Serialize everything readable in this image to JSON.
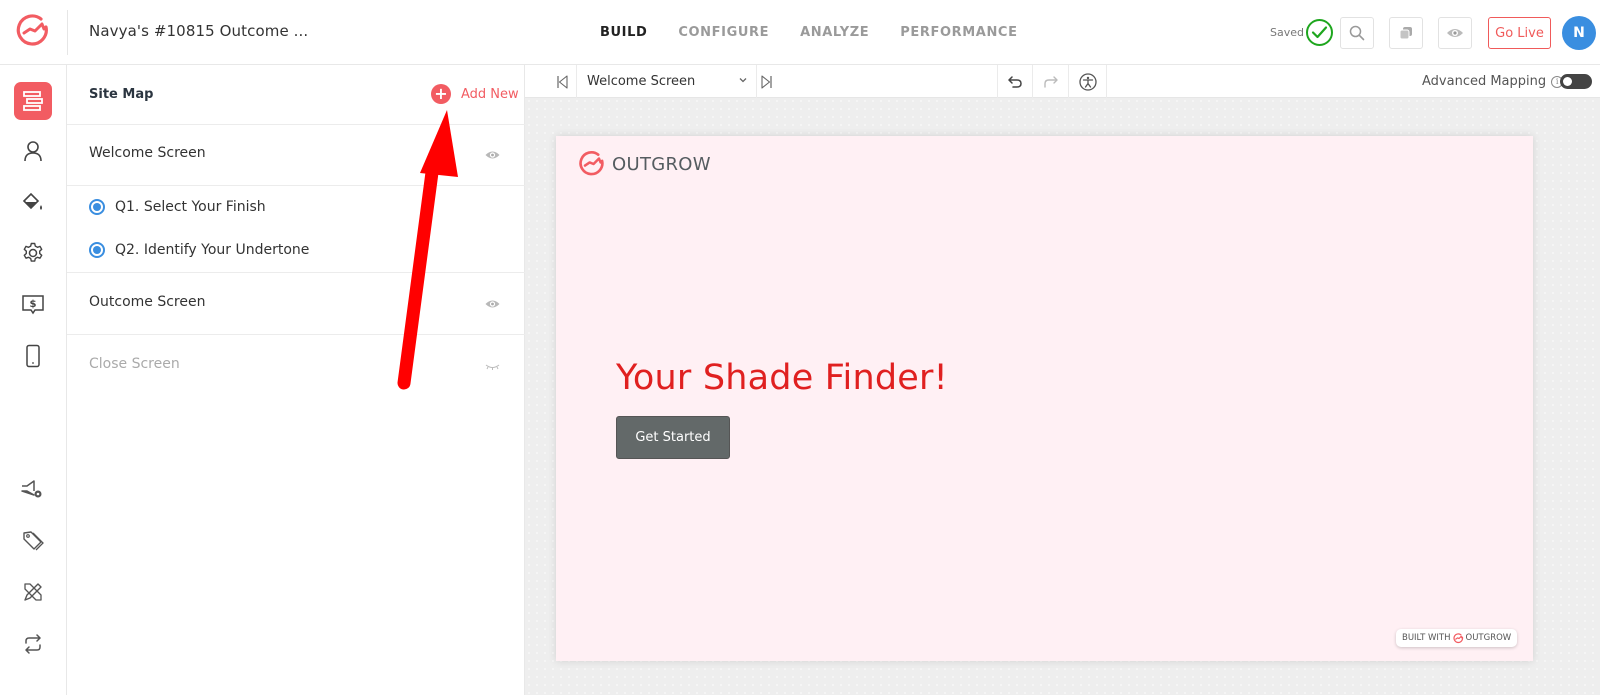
{
  "header": {
    "project_title": "Navya's #10815 Outcome ...",
    "nav": [
      {
        "label": "BUILD",
        "active": true
      },
      {
        "label": "CONFIGURE",
        "active": false
      },
      {
        "label": "ANALYZE",
        "active": false
      },
      {
        "label": "PERFORMANCE",
        "active": false
      }
    ],
    "saved_label": "Saved",
    "go_live_label": "Go Live",
    "avatar_initial": "N",
    "icons": [
      "logo-icon",
      "saved-check-icon",
      "search-icon",
      "duplicate-icon",
      "preview-eye-icon"
    ]
  },
  "iconbar": {
    "items": [
      {
        "icon": "site-map-icon",
        "active": true
      },
      {
        "icon": "user-icon",
        "active": false
      },
      {
        "icon": "paint-bucket-icon",
        "active": false
      },
      {
        "icon": "gear-icon",
        "active": false
      },
      {
        "icon": "pricing-icon",
        "active": false
      },
      {
        "icon": "mobile-icon",
        "active": false
      },
      {
        "icon": "announcement-settings-icon",
        "active": false
      },
      {
        "icon": "tag-icon",
        "active": false
      },
      {
        "icon": "design-tools-icon",
        "active": false
      },
      {
        "icon": "repeat-icon",
        "active": false
      }
    ]
  },
  "sitemap": {
    "title": "Site Map",
    "add_new_label": "Add New",
    "welcome_screen": "Welcome Screen",
    "questions": [
      {
        "label": "Q1. Select Your Finish"
      },
      {
        "label": "Q2. Identify Your Undertone"
      }
    ],
    "outcome_screen": "Outcome Screen",
    "close_screen": "Close Screen"
  },
  "toolbar": {
    "selected_screen": "Welcome Screen",
    "advanced_mapping_label": "Advanced Mapping",
    "advanced_mapping_on": false
  },
  "preview": {
    "brand_name": "OUTGROW",
    "headline": "Your Shade Finder!",
    "cta_label": "Get Started",
    "built_with_label": "BUILT WITH",
    "built_with_brand": "OUTGROW",
    "colors": {
      "background": "#fff0f4",
      "headline": "#e02020",
      "cta": "#636969"
    }
  },
  "colors": {
    "accent": "#f25c62",
    "radio": "#3a8ee0",
    "saved": "#1ea61e",
    "annotation_arrow": "#ff0000"
  }
}
